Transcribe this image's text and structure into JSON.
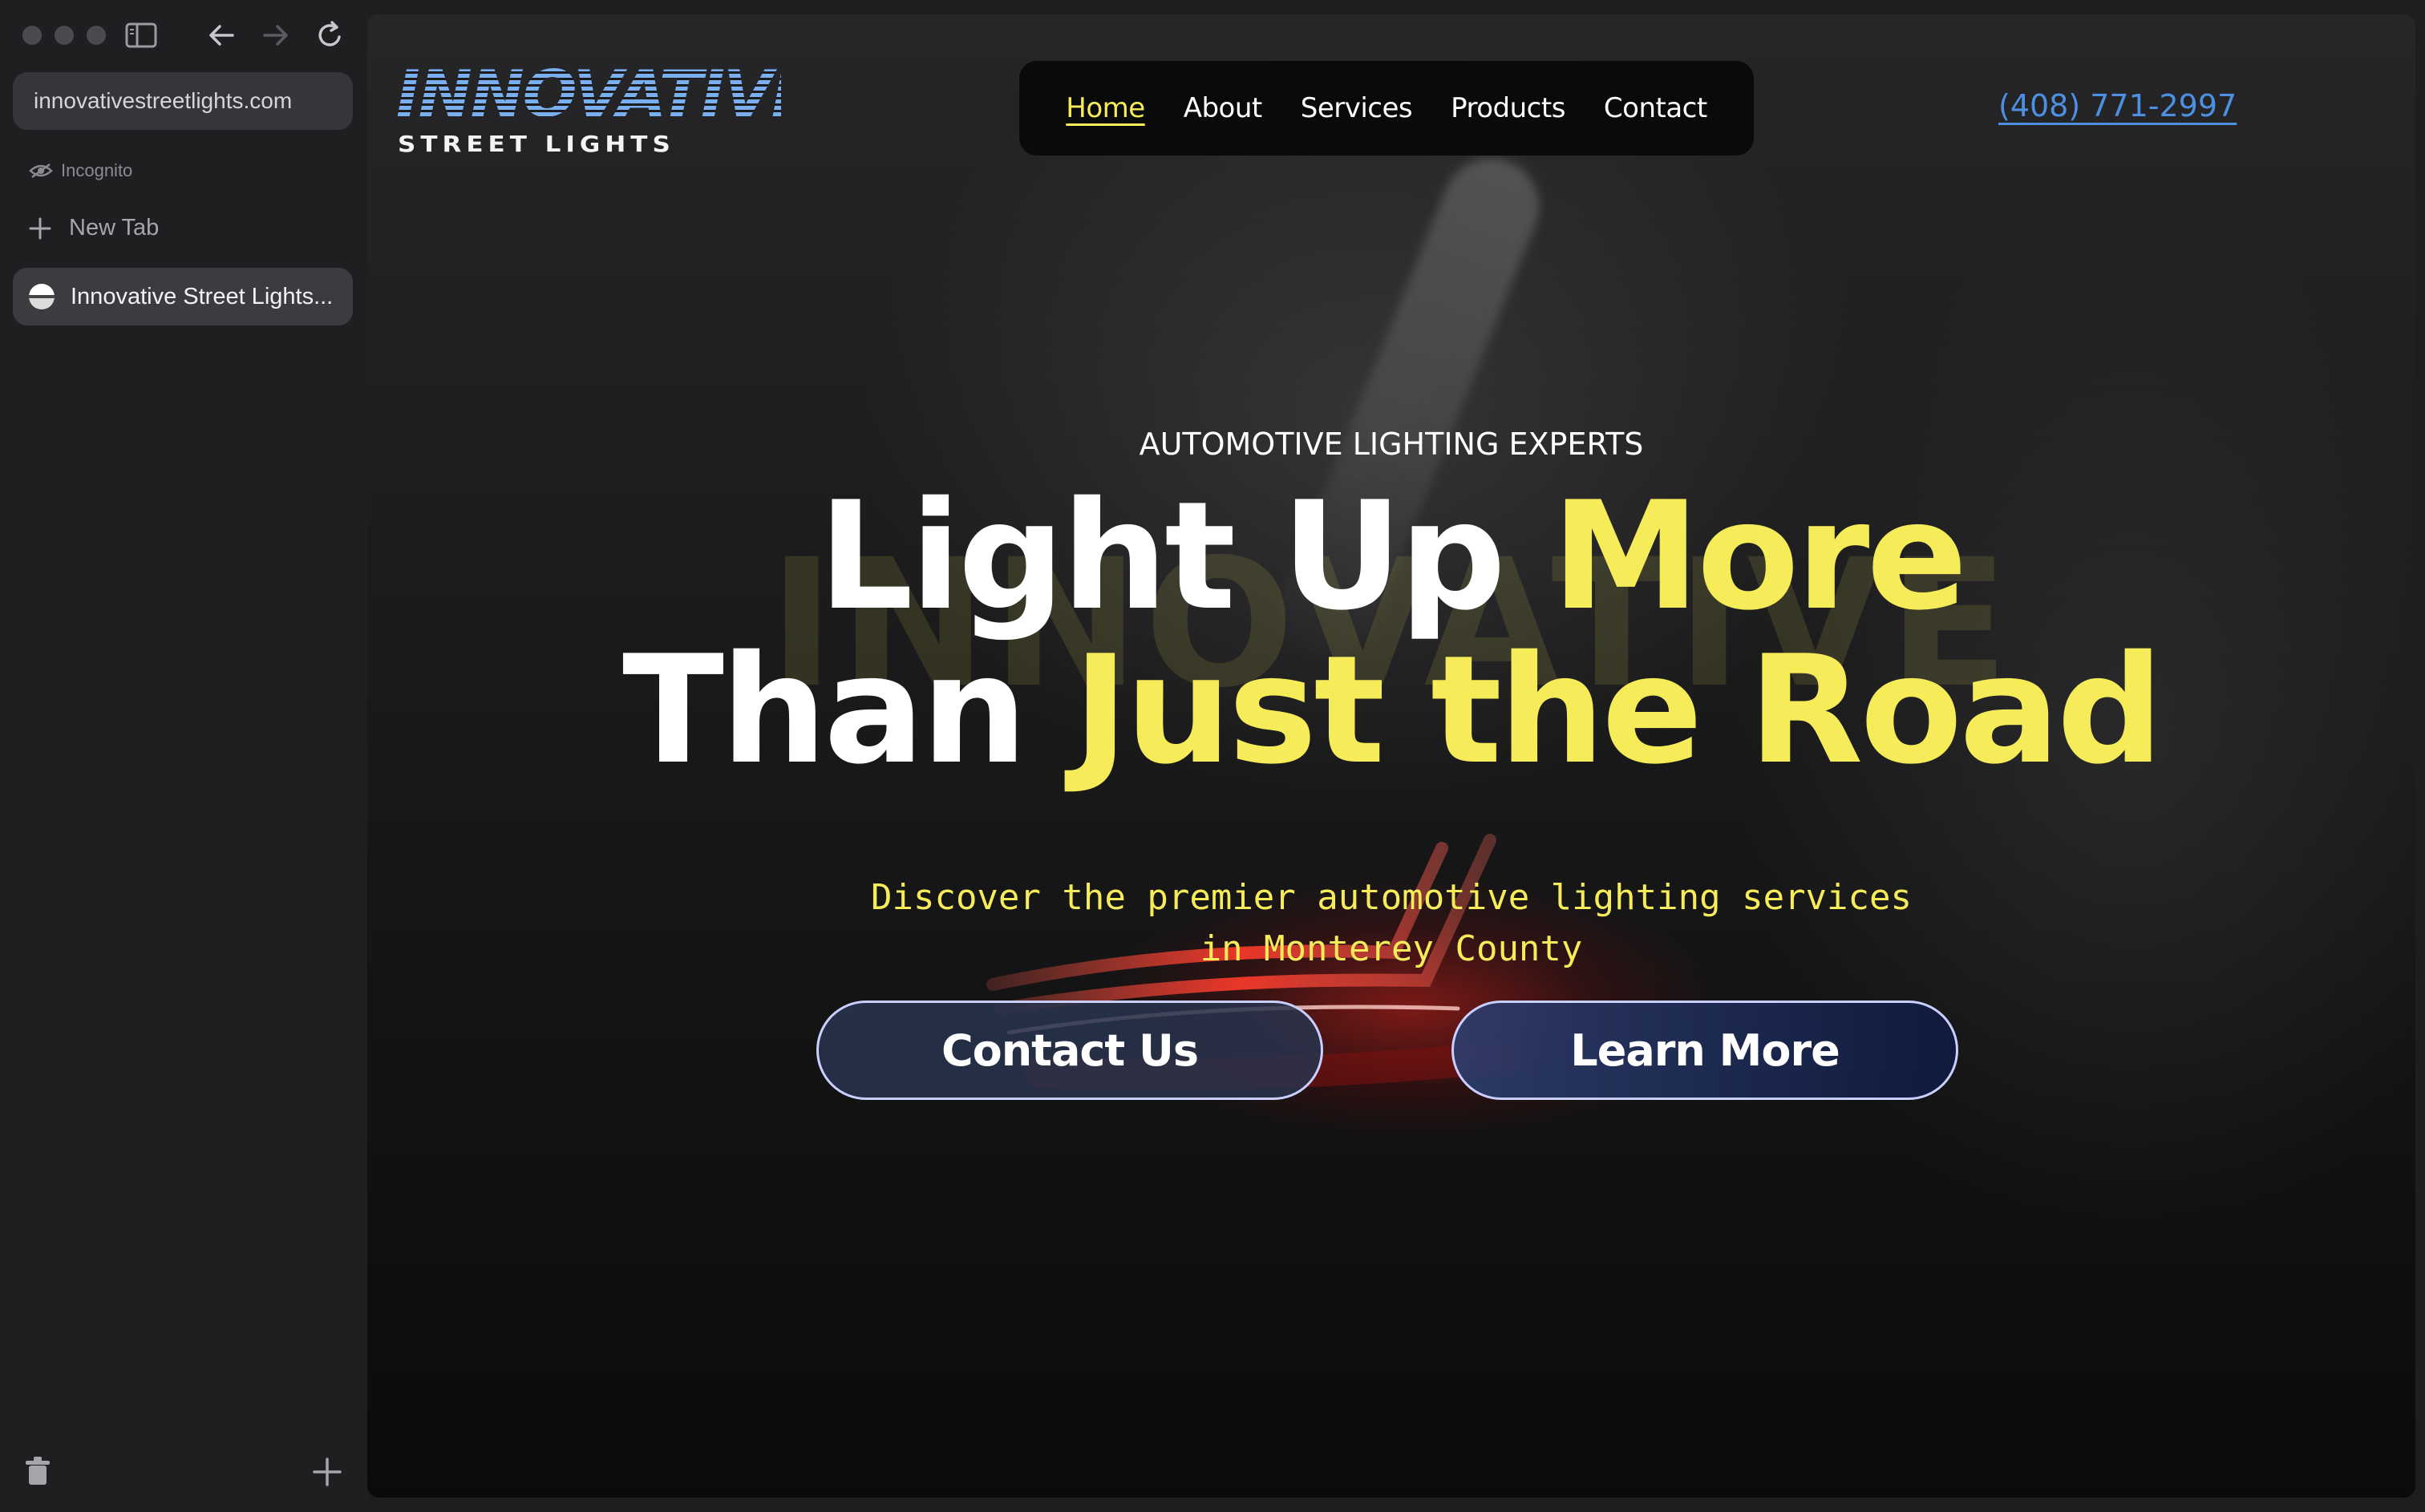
{
  "browser": {
    "url": "innovativestreetlights.com",
    "mode_label": "Incognito",
    "new_tab_label": "New Tab",
    "active_tab_title": "Innovative Street Lights..."
  },
  "site": {
    "logo": {
      "main": "INNOVATIVE",
      "sub": "STREET LIGHTS"
    },
    "nav": [
      {
        "label": "Home",
        "active": true
      },
      {
        "label": "About",
        "active": false
      },
      {
        "label": "Services",
        "active": false
      },
      {
        "label": "Products",
        "active": false
      },
      {
        "label": "Contact",
        "active": false
      }
    ],
    "phone": "(408) 771-2997"
  },
  "hero": {
    "eyebrow": "AUTOMOTIVE LIGHTING EXPERTS",
    "watermark": "INNOVATIVE",
    "headline_line1_white": "Light Up ",
    "headline_line1_yellow": "More",
    "headline_line2_white": "Than ",
    "headline_line2_yellow": "Just the Road",
    "subtitle_line1": "Discover the premier automotive lighting services",
    "subtitle_line2": "in Monterey County",
    "buttons": {
      "contact": "Contact Us",
      "learn": "Learn More"
    }
  },
  "colors": {
    "accent_yellow": "#f6ec5a",
    "link_blue": "#4d8fe0",
    "button_border": "#c9d0ff"
  }
}
